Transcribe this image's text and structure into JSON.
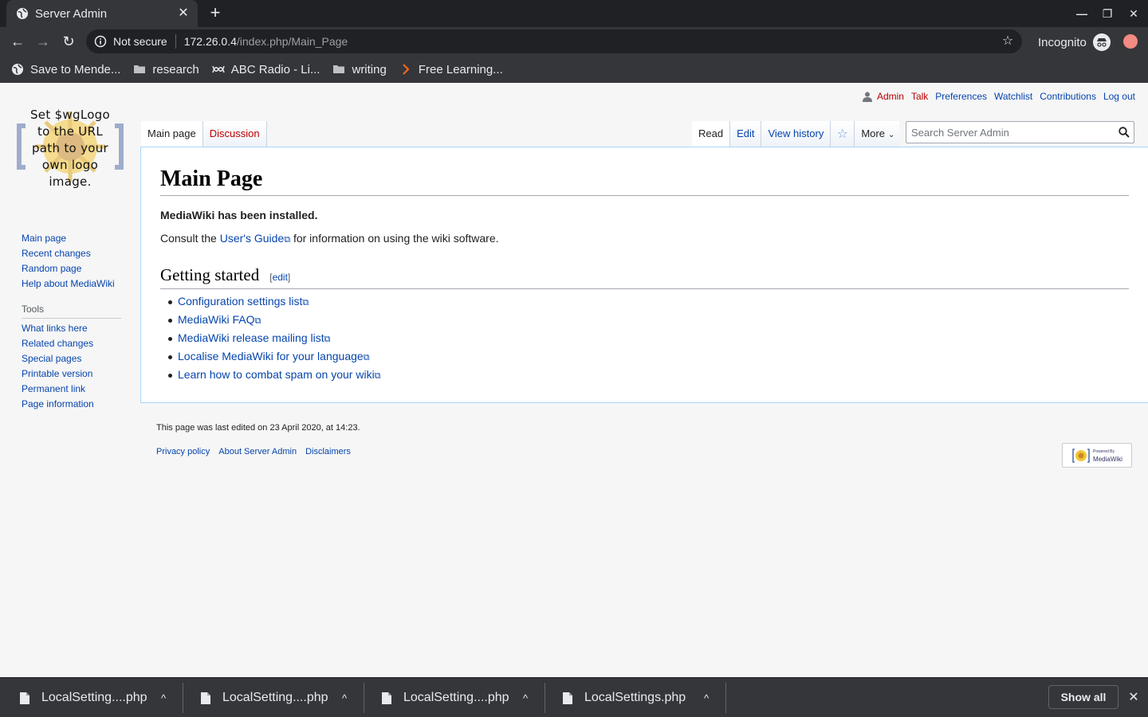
{
  "browser": {
    "tab_title": "Server Admin",
    "tab_close": "✕",
    "new_tab": "+",
    "minimize": "—",
    "maximize": "❐",
    "close": "✕",
    "back": "←",
    "forward": "→",
    "reload": "↻",
    "security_label": "Not secure",
    "url_host": "172.26.0.4",
    "url_path": "/index.php/Main_Page",
    "bookmark_star": "☆",
    "incognito_label": "Incognito",
    "bookmarks": [
      {
        "label": "Save to Mende...",
        "icon": "globe-icon"
      },
      {
        "label": "research",
        "icon": "folder-icon"
      },
      {
        "label": "ABC Radio - Li...",
        "icon": "abc-icon"
      },
      {
        "label": "writing",
        "icon": "folder-icon"
      },
      {
        "label": "Free Learning...",
        "icon": "packt-icon"
      }
    ]
  },
  "wiki": {
    "logo_text": [
      "Set $wgLogo",
      "to the URL",
      "path to your",
      "own logo",
      "image."
    ],
    "personal": {
      "user": "Admin",
      "talk": "Talk",
      "preferences": "Preferences",
      "watchlist": "Watchlist",
      "contributions": "Contributions",
      "logout": "Log out"
    },
    "tabs": {
      "main_page": "Main page",
      "discussion": "Discussion",
      "read": "Read",
      "edit": "Edit",
      "view_history": "View history",
      "watch_star": "☆",
      "more": "More",
      "more_chev": "⌄"
    },
    "search_placeholder": "Search Server Admin",
    "title": "Main Page",
    "installed": "MediaWiki has been installed.",
    "consult_before": "Consult the ",
    "consult_link": "User's Guide",
    "consult_after": " for information on using the wiki software.",
    "ext_icon": "⧉",
    "section_title": "Getting started",
    "section_edit_open": "[",
    "section_edit": "edit",
    "section_edit_close": "]",
    "links": [
      "Configuration settings list",
      "MediaWiki FAQ",
      "MediaWiki release mailing list",
      "Localise MediaWiki for your language",
      "Learn how to combat spam on your wiki"
    ],
    "sidebar": [
      "Main page",
      "Recent changes",
      "Random page",
      "Help about MediaWiki"
    ],
    "tools_heading": "Tools",
    "tools": [
      "What links here",
      "Related changes",
      "Special pages",
      "Printable version",
      "Permanent link",
      "Page information"
    ],
    "last_edited": "This page was last edited on 23 April 2020, at 14:23.",
    "footer_links": [
      "Privacy policy",
      "About Server Admin",
      "Disclaimers"
    ],
    "powered_small": "Powered By",
    "powered_main": "MediaWiki"
  },
  "downloads": {
    "items": [
      "LocalSetting....php",
      "LocalSetting....php",
      "LocalSetting....php",
      "LocalSettings.php"
    ],
    "caret": "^",
    "show_all": "Show all",
    "close": "✕"
  },
  "colors": {
    "link": "#0645ad",
    "new_link": "#ba0000",
    "chrome_dark": "#202124",
    "chrome_toolbar": "#35363a"
  }
}
